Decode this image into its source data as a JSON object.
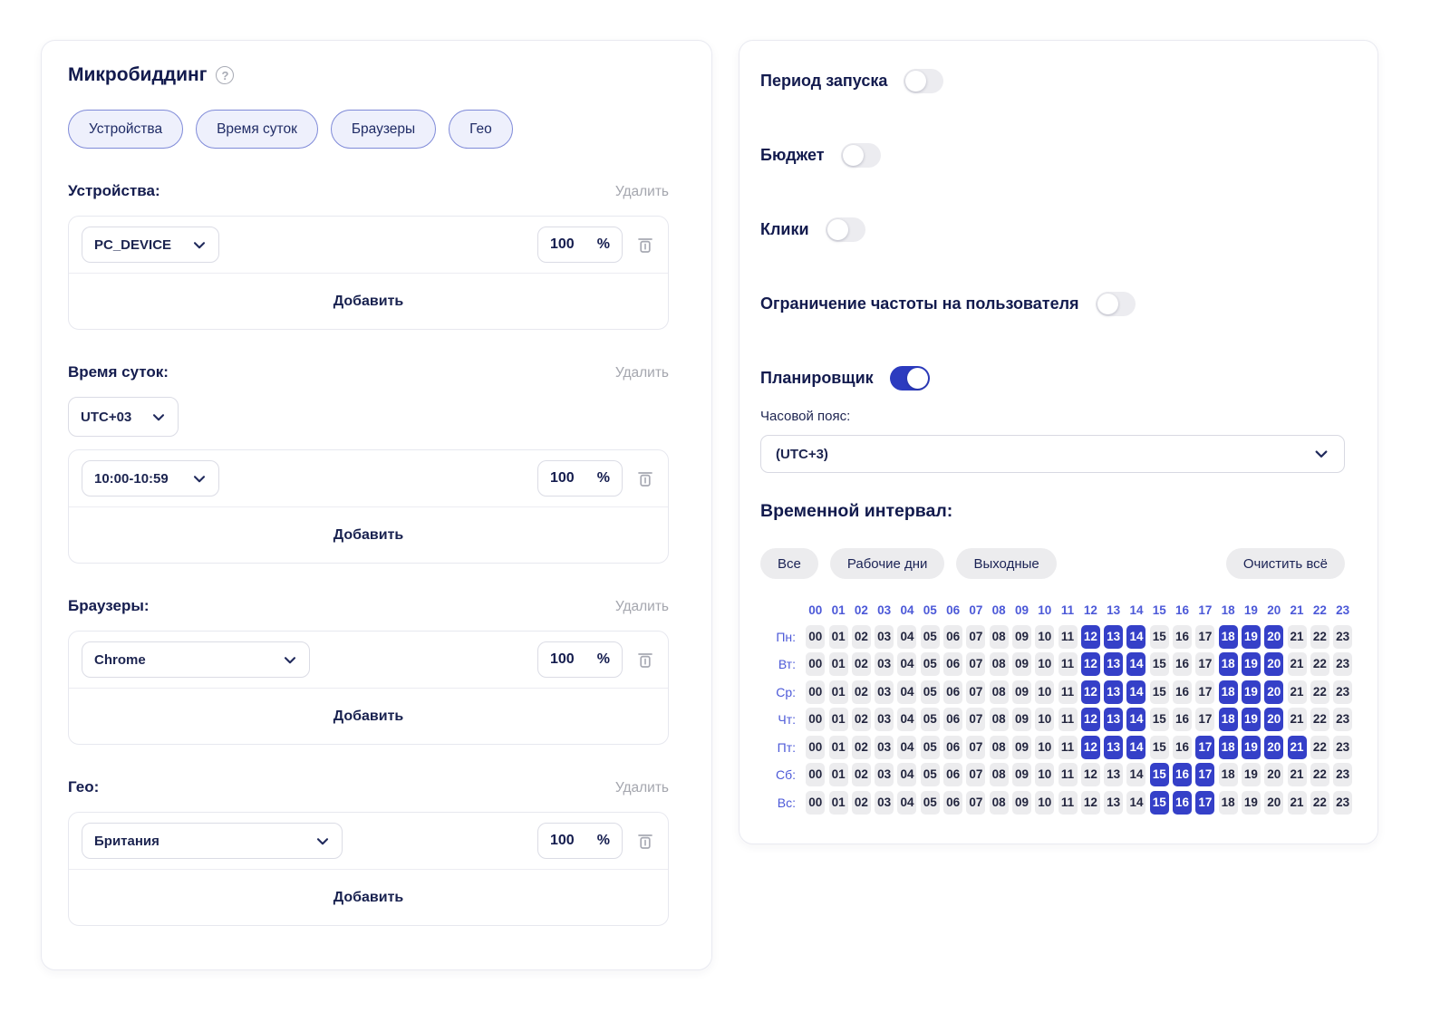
{
  "left_panel": {
    "title": "Микробиддинг",
    "help_icon": "question-circle-icon",
    "chips": [
      "Устройства",
      "Время суток",
      "Браузеры",
      "Гео"
    ],
    "delete_label": "Удалить",
    "add_label": "Добавить",
    "sections": [
      {
        "label": "Устройства:",
        "select_value": "PC_DEVICE",
        "percent": "100",
        "unit": "%"
      },
      {
        "label": "Время суток:",
        "timezone_select": "UTC+03",
        "select_value": "10:00-10:59",
        "percent": "100",
        "unit": "%"
      },
      {
        "label": "Браузеры:",
        "select_value": "Chrome",
        "percent": "100",
        "unit": "%"
      },
      {
        "label": "Гео:",
        "select_value": "Британия",
        "percent": "100",
        "unit": "%"
      }
    ]
  },
  "right_panel": {
    "toggles": [
      {
        "label": "Период запуска",
        "on": false
      },
      {
        "label": "Бюджет",
        "on": false
      },
      {
        "label": "Клики",
        "on": false
      },
      {
        "label": "Ограничение частоты на пользователя",
        "on": false
      },
      {
        "label": "Планировщик",
        "on": true
      }
    ],
    "timezone_label": "Часовой пояс:",
    "timezone_value": "(UTC+3)",
    "interval_title": "Временной интервал:",
    "preset_buttons": [
      "Все",
      "Рабочие дни",
      "Выходные"
    ],
    "clear_button": "Очистить всё",
    "hours": [
      "00",
      "01",
      "02",
      "03",
      "04",
      "05",
      "06",
      "07",
      "08",
      "09",
      "10",
      "11",
      "12",
      "13",
      "14",
      "15",
      "16",
      "17",
      "18",
      "19",
      "20",
      "21",
      "22",
      "23"
    ],
    "days": [
      {
        "label": "Пн:",
        "selected": [
          12,
          13,
          14,
          18,
          19,
          20
        ]
      },
      {
        "label": "Вт:",
        "selected": [
          12,
          13,
          14,
          18,
          19,
          20
        ]
      },
      {
        "label": "Ср:",
        "selected": [
          12,
          13,
          14,
          18,
          19,
          20
        ]
      },
      {
        "label": "Чт:",
        "selected": [
          12,
          13,
          14,
          18,
          19,
          20
        ]
      },
      {
        "label": "Пт:",
        "selected": [
          12,
          13,
          14,
          17,
          18,
          19,
          20,
          21
        ]
      },
      {
        "label": "Сб:",
        "selected": [
          15,
          16,
          17
        ]
      },
      {
        "label": "Вс:",
        "selected": [
          15,
          16,
          17
        ]
      }
    ]
  },
  "colors": {
    "accent_blue": "#3540c8",
    "toggle_on": "#2c3bbf",
    "grid_text_blue": "#4c59d8",
    "chip_border": "#7f8ad8",
    "muted_gray": "#a4a6ae"
  }
}
